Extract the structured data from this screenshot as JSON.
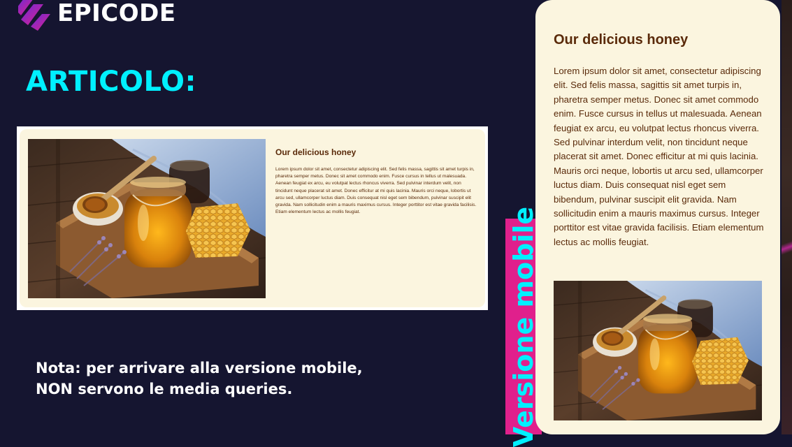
{
  "brand": {
    "name": "EPICODE",
    "colors": {
      "cyan": "#00f0ff",
      "magenta": "#e0208c",
      "purple": "#6a2ad8"
    }
  },
  "heading": "ARTICOLO:",
  "article": {
    "title": "Our delicious honey",
    "body": "Lorem ipsum dolor sit amet, consectetur adipiscing elit. Sed felis massa, sagittis sit amet turpis in, pharetra semper metus. Donec sit amet commodo enim. Fusce cursus in tellus ut malesuada. Aenean feugiat ex arcu, eu volutpat lectus rhoncus viverra. Sed pulvinar interdum velit, non tincidunt neque placerat sit amet. Donec efficitur at mi quis lacinia. Mauris orci neque, lobortis ut arcu sed, ullamcorper luctus diam. Duis consequat nisl eget sem bibendum, pulvinar suscipit elit gravida. Nam sollicitudin enim a mauris maximus cursus. Integer porttitor est vitae gravida facilisis. Etiam elementum lectus ac mollis feugiat.",
    "image_icon": "honey-jar-photo"
  },
  "note": "Nota: per arrivare alla versione mobile, NON servono le media queries.",
  "mobile_label": "Versione mobile"
}
